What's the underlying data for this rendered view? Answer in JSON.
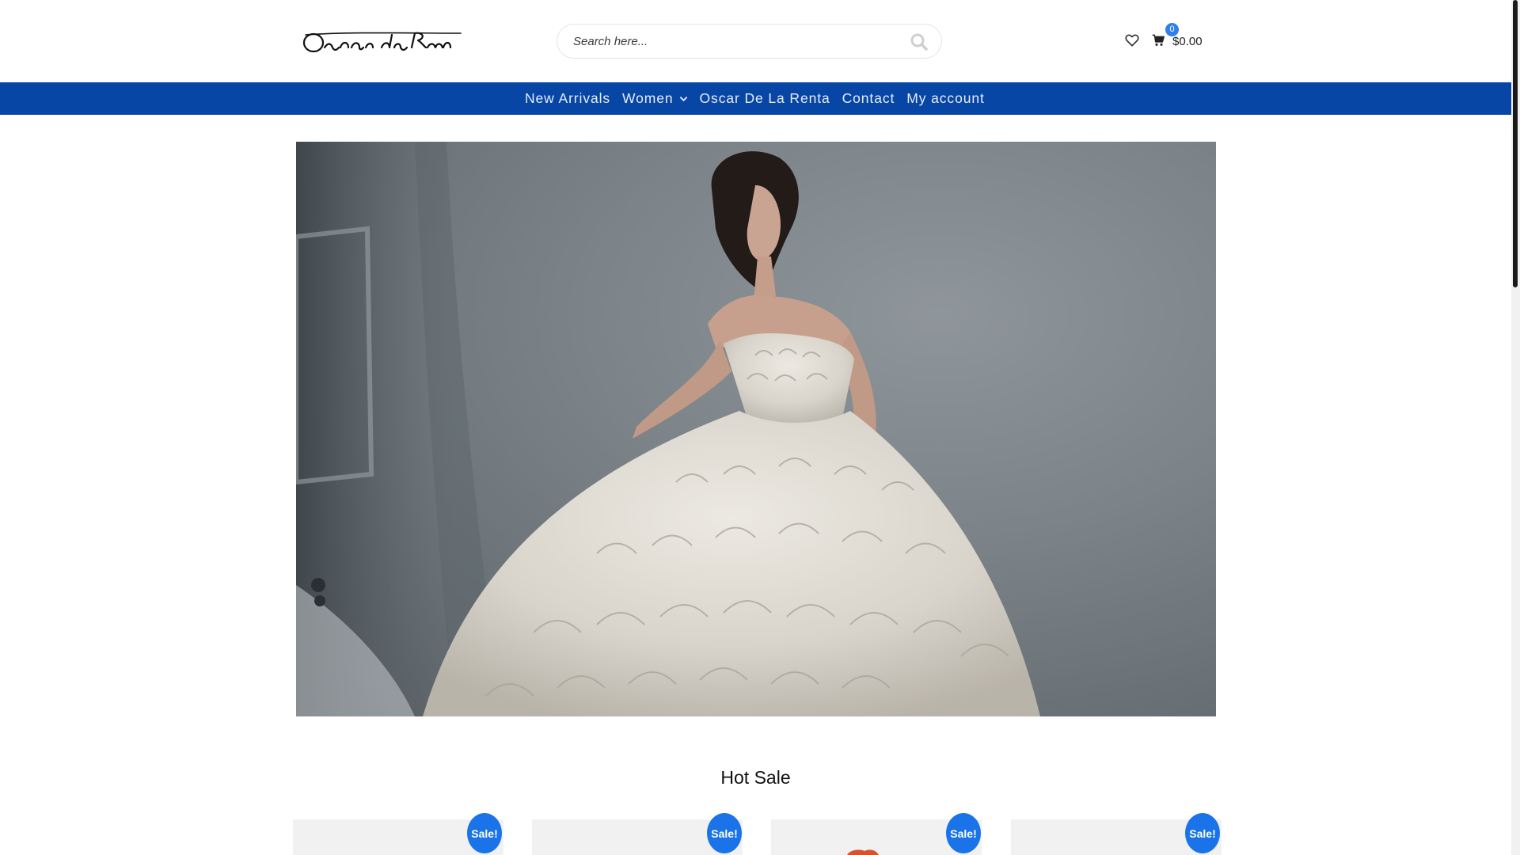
{
  "header": {
    "search_placeholder": "Search here...",
    "cart_count": "0",
    "cart_total": "$0.00"
  },
  "nav": {
    "items": [
      "New Arrivals",
      "Women",
      "Oscar De La Renta",
      "Contact",
      "My account"
    ]
  },
  "hero": {
    "alt": "Model in white strapless petal gown"
  },
  "hot_sale": {
    "title": "Hot Sale",
    "badges": [
      "Sale!",
      "Sale!",
      "Sale!",
      "Sale!"
    ]
  },
  "icons": {
    "search": "search-icon",
    "wishlist": "heart-icon",
    "cart": "cart-icon",
    "dropdown": "chevron-down-icon"
  },
  "colors": {
    "nav_bg": "#0846a6",
    "badge": "#1a73e8",
    "cart_badge": "#2f80ed"
  }
}
